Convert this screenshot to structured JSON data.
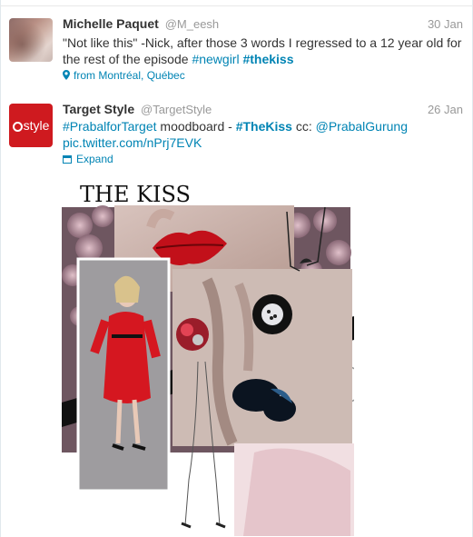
{
  "tweets": [
    {
      "fullname": "Michelle Paquet",
      "username": "@M_eesh",
      "time": "30 Jan",
      "text_plain": "\"Not like this\" -Nick, after those 3 words I regressed to a 12 year old for the rest of the episode ",
      "hashtag1": "#newgirl",
      "hashtag2": "#thekiss",
      "location": "from Montréal, Québec",
      "avatar_icon": "profile-photo"
    },
    {
      "fullname": "Target Style",
      "username": "@TargetStyle",
      "time": "26 Jan",
      "hashtag1": "#PrabalforTarget",
      "text_middle": " moodboard - ",
      "hashtag2": "#TheKiss",
      "text_cc": " cc: ",
      "mention": "@PrabalGurung",
      "link": "pic.twitter.com/nPrj7EVK",
      "expand": "Expand",
      "avatar_label": "style",
      "media_title": "THE KISS"
    }
  ],
  "colors": {
    "link": "#0084b4",
    "brand_target": "#cf1a1f",
    "muted": "#999999",
    "text": "#333333"
  },
  "icons": [
    "location-pin-icon",
    "photo-expand-icon"
  ]
}
